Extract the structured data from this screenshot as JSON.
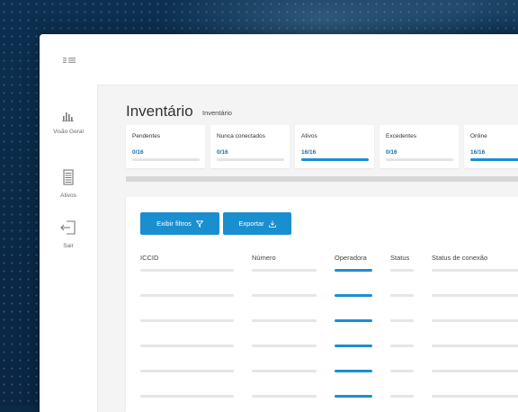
{
  "sidebar": {
    "items": [
      {
        "label": "Visão Geral",
        "icon": "bar-chart-icon"
      },
      {
        "label": "Ativos",
        "icon": "sim-stack-icon"
      },
      {
        "label": "Sair",
        "icon": "logout-icon"
      }
    ]
  },
  "header": {
    "menu_icon": "menu-icon"
  },
  "page": {
    "title": "Inventário",
    "breadcrumb": "Inventário"
  },
  "stats": [
    {
      "label": "Pendentes",
      "value": "0/16",
      "progress": 0
    },
    {
      "label": "Nunca conectados",
      "value": "0/16",
      "progress": 0
    },
    {
      "label": "Ativos",
      "value": "16/16",
      "progress": 1
    },
    {
      "label": "Excedentes",
      "value": "0/16",
      "progress": 0
    },
    {
      "label": "Online",
      "value": "16/16",
      "progress": 1
    }
  ],
  "toolbar": {
    "filter_label": "Exibir filtros",
    "export_label": "Exportar"
  },
  "table": {
    "columns": [
      "ICCID",
      "Número",
      "Operadora",
      "Status",
      "Status de conexão"
    ],
    "row_count": 6
  },
  "colors": {
    "accent": "#1a8fd0",
    "background": "#0b2a45"
  }
}
